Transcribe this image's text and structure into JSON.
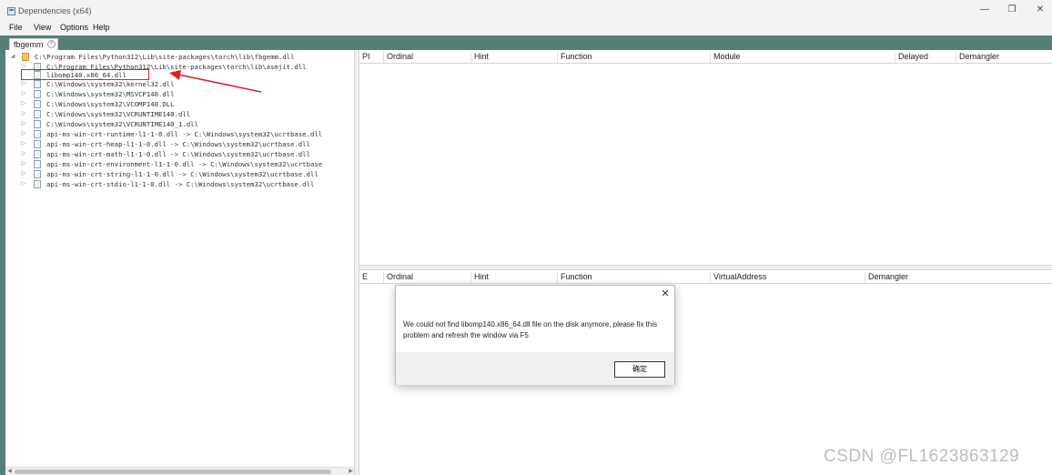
{
  "window": {
    "title": "Dependencies (x64)",
    "minimize": "—",
    "maximize": "❐",
    "close": "✕"
  },
  "menu": [
    "File",
    "View",
    "Options",
    "Help"
  ],
  "tab": {
    "label": "fbgemm",
    "close": "×"
  },
  "tree": {
    "items": [
      {
        "text": "C:\\Program Files\\Python312\\Lib\\site-packages\\torch\\lib\\fbgemm.dll",
        "expander": "◢"
      },
      {
        "text": "C:\\Program Files\\Python312\\Lib\\site-packages\\torch\\lib\\asmjit.dll",
        "expander": "▷"
      },
      {
        "text": "libomp140.x86_64.dll",
        "expander": ""
      },
      {
        "text": "C:\\Windows\\system32\\kernel32.dll",
        "expander": "▷"
      },
      {
        "text": "C:\\Windows\\system32\\MSVCP140.dll",
        "expander": "▷"
      },
      {
        "text": "C:\\Windows\\system32\\VCOMP140.DLL",
        "expander": "▷"
      },
      {
        "text": "C:\\Windows\\system32\\VCRUNTIME140.dll",
        "expander": "▷"
      },
      {
        "text": "C:\\Windows\\system32\\VCRUNTIME140_1.dll",
        "expander": "▷"
      },
      {
        "text": "api-ms-win-crt-runtime-l1-1-0.dll -> C:\\Windows\\system32\\ucrtbase.dll",
        "expander": "▷"
      },
      {
        "text": "api-ms-win-crt-heap-l1-1-0.dll -> C:\\Windows\\system32\\ucrtbase.dll",
        "expander": "▷"
      },
      {
        "text": "api-ms-win-crt-math-l1-1-0.dll -> C:\\Windows\\system32\\ucrtbase.dll",
        "expander": "▷"
      },
      {
        "text": "api-ms-win-crt-environment-l1-1-0.dll -> C:\\Windows\\system32\\ucrtbase",
        "expander": "▷"
      },
      {
        "text": "api-ms-win-crt-string-l1-1-0.dll -> C:\\Windows\\system32\\ucrtbase.dll",
        "expander": "▷"
      },
      {
        "text": "api-ms-win-crt-stdio-l1-1-0.dll -> C:\\Windows\\system32\\ucrtbase.dll",
        "expander": "▷"
      }
    ],
    "scroll_left": "◀",
    "scroll_right": "▶"
  },
  "imports_grid": {
    "columns": [
      "PI",
      "Ordinal",
      "Hint",
      "Function",
      "Module",
      "Delayed",
      "Demangler"
    ]
  },
  "exports_grid": {
    "columns": [
      "E",
      "Ordinal",
      "Hint",
      "Function",
      "VirtualAddress",
      "Demangler"
    ]
  },
  "dialog": {
    "close": "✕",
    "message": "We could not find libomp140.x86_64.dll file on the disk anymore, please fix this problem and refresh the window via F5",
    "ok_label": "确定"
  },
  "watermark": "CSDN @FL1623863129",
  "colors": {
    "accent": "#567f78",
    "highlight": "#e02020"
  }
}
